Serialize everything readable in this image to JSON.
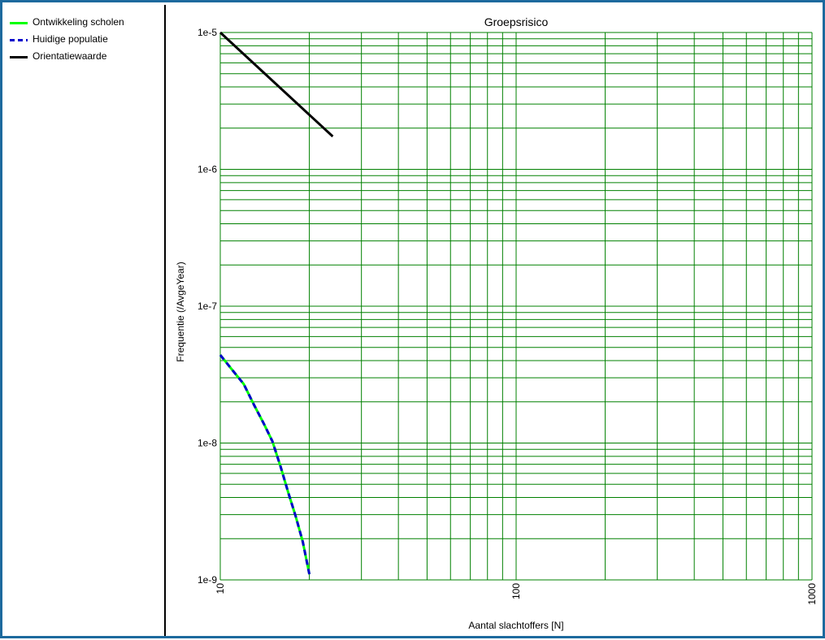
{
  "legend": {
    "items": [
      {
        "label": "Ontwikkeling scholen",
        "color": "#00ff00",
        "style": "solid"
      },
      {
        "label": "Huidige populatie",
        "color": "#0000cc",
        "style": "dashed"
      },
      {
        "label": "Orientatiewaarde",
        "color": "#000000",
        "style": "solid"
      }
    ]
  },
  "chart_data": {
    "type": "line",
    "title": "Groepsrisico",
    "xlabel": "Aantal slachtoffers [N]",
    "ylabel": "Frequentie (/AvgeYear)",
    "xscale": "log",
    "yscale": "log",
    "xlim": [
      10,
      1000
    ],
    "ylim": [
      1e-09,
      1e-05
    ],
    "grid": true,
    "grid_color": "#008000",
    "legend_position": "left-panel",
    "x_tick_labels": [
      "10",
      "100",
      "1000"
    ],
    "y_tick_labels": [
      "1e-9",
      "1e-8",
      "1e-7",
      "1e-6",
      "1e-5"
    ],
    "series": [
      {
        "name": "Orientatiewaarde",
        "color": "#000000",
        "style": "solid",
        "x": [
          10,
          24
        ],
        "y": [
          1e-05,
          1.74e-06
        ]
      },
      {
        "name": "Ontwikkeling scholen",
        "color": "#00ff00",
        "style": "solid",
        "x": [
          10,
          11,
          12,
          13,
          14,
          15,
          16,
          17,
          18,
          19,
          20
        ],
        "y": [
          4.4e-08,
          3.4e-08,
          2.7e-08,
          1.9e-08,
          1.4e-08,
          1.03e-08,
          6.7e-09,
          4.3e-09,
          2.9e-09,
          1.9e-09,
          1.1e-09
        ]
      },
      {
        "name": "Huidige populatie",
        "color": "#0000cc",
        "style": "dashed",
        "x": [
          10,
          11,
          12,
          13,
          14,
          15,
          16,
          17,
          18,
          19,
          20
        ],
        "y": [
          4.4e-08,
          3.4e-08,
          2.7e-08,
          1.9e-08,
          1.4e-08,
          1.03e-08,
          6.7e-09,
          4.3e-09,
          2.9e-09,
          1.9e-09,
          1.1e-09
        ]
      }
    ]
  }
}
